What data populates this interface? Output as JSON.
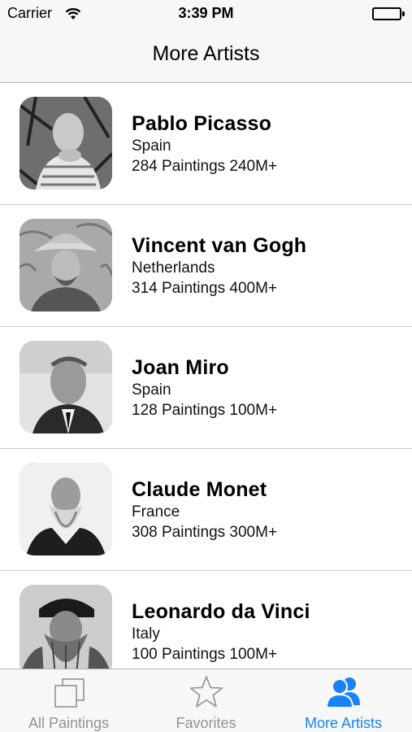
{
  "status_bar": {
    "carrier": "Carrier",
    "time": "3:39 PM"
  },
  "nav": {
    "title": "More Artists"
  },
  "artists": [
    {
      "name": "Pablo Picasso",
      "country": "Spain",
      "stats": "284 Paintings 240M+"
    },
    {
      "name": "Vincent van Gogh",
      "country": "Netherlands",
      "stats": "314 Paintings 400M+"
    },
    {
      "name": "Joan Miro",
      "country": "Spain",
      "stats": "128 Paintings 100M+"
    },
    {
      "name": "Claude Monet",
      "country": "France",
      "stats": "308 Paintings 300M+"
    },
    {
      "name": "Leonardo da Vinci",
      "country": "Italy",
      "stats": "100 Paintings 100M+"
    }
  ],
  "tabs": [
    {
      "label": "All Paintings",
      "icon": "stacked-squares-icon",
      "active": false
    },
    {
      "label": "Favorites",
      "icon": "star-icon",
      "active": false
    },
    {
      "label": "More Artists",
      "icon": "people-icon",
      "active": true
    }
  ],
  "colors": {
    "accent": "#1a82f7",
    "inactive_tab": "#929292",
    "bar_background": "#f7f7f7"
  }
}
